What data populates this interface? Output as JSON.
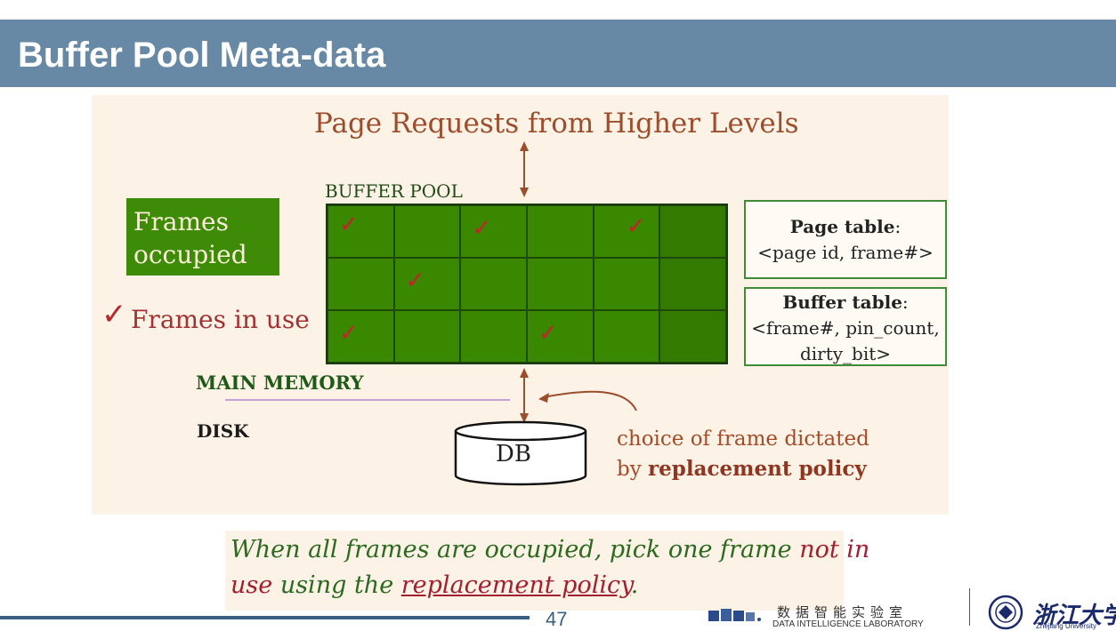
{
  "header": {
    "title": "Buffer Pool Meta-data"
  },
  "diagram": {
    "request_title": "Page Requests from Higher Levels",
    "buffer_pool_label": "BUFFER POOL",
    "frames_occupied": [
      "Frames",
      "occupied"
    ],
    "frames_in_use": "Frames in use",
    "check_glyph": "✓",
    "page_table": {
      "title": "Page table",
      "colon": ":",
      "fields": "<page id, frame#>"
    },
    "buffer_table": {
      "title": "Buffer table",
      "colon": ":",
      "fields_line1": "<frame#, pin_count,",
      "fields_line2": "dirty_bit>"
    },
    "main_memory": "MAIN MEMORY",
    "disk": "DISK",
    "db": "DB",
    "choice_line1": "choice of frame dictated",
    "choice_line2_prefix": "by ",
    "choice_line2_bold": "replacement policy",
    "grid": {
      "rows": 3,
      "cols": 6,
      "in_use": [
        [
          0,
          0
        ],
        [
          0,
          2
        ],
        [
          0,
          4
        ],
        [
          1,
          1
        ],
        [
          2,
          0
        ],
        [
          2,
          3
        ]
      ]
    }
  },
  "caption": {
    "part1": "When all frames are occupied, pick one frame ",
    "part2": "not in",
    "part3": "use",
    "part4": " using the ",
    "part5": "replacement policy",
    "part6": "."
  },
  "footer": {
    "page_number": "47",
    "lab_name_cn": "数据智能实验室",
    "lab_name_en": "DATA INTELLIGENCE LABORATORY",
    "university_cn": "浙江大学",
    "university_en": "Zhejiang University"
  },
  "colors": {
    "header_bg": "#6889a5",
    "frame_green": "#3a8800",
    "check_red": "#c8202c",
    "figure_bg": "#fdf2e6"
  }
}
